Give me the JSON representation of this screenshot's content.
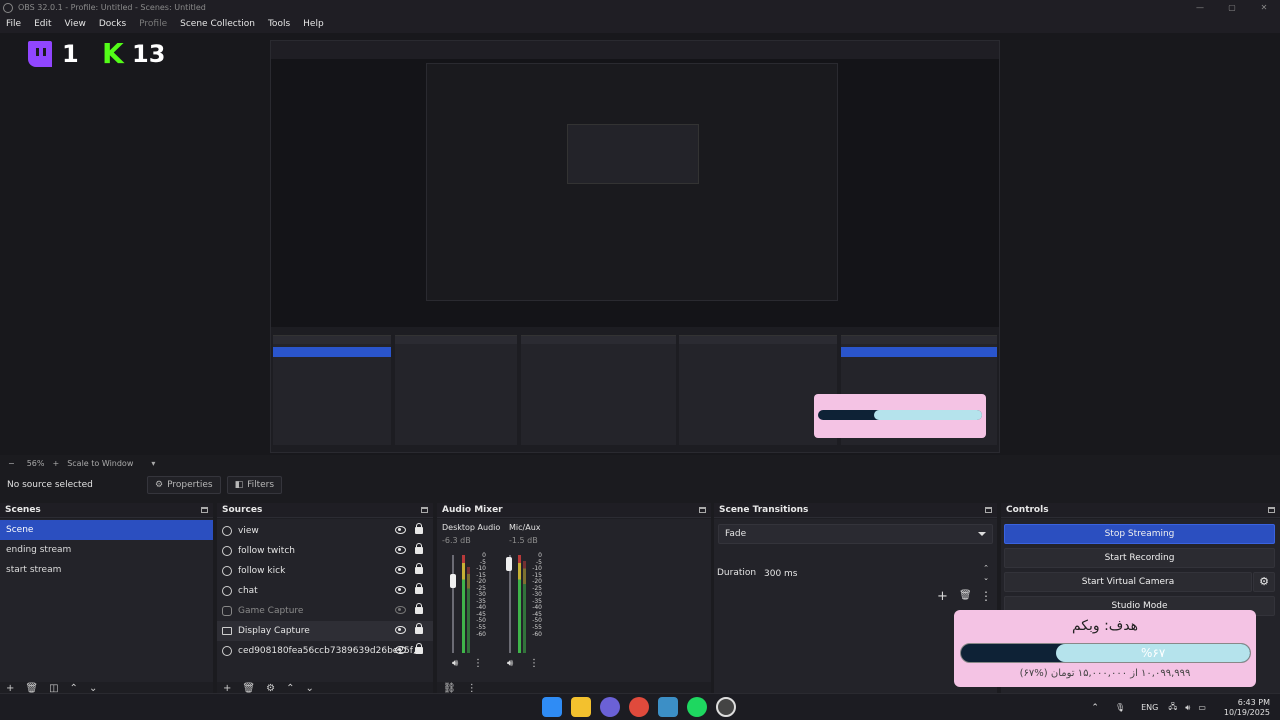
{
  "window": {
    "title": "OBS 32.0.1 - Profile: Untitled - Scenes: Untitled",
    "controls": [
      "—",
      "▢",
      "✕"
    ]
  },
  "menu": [
    "File",
    "Edit",
    "View",
    "Docks",
    "Profile",
    "Scene Collection",
    "Tools",
    "Help"
  ],
  "menu_disabled": [
    "Profile"
  ],
  "preview": {
    "twitch_count": "1",
    "kick_count": "13",
    "twitch_color": "#9146ff",
    "kick_color": "#53fc18"
  },
  "zoom": {
    "minus": "−",
    "level": "56%",
    "plus": "+",
    "mode": "Scale to Window",
    "caret": "▾"
  },
  "source_toolbar": {
    "no_source": "No source selected",
    "properties": "Properties",
    "filters": "Filters",
    "properties_icon": "gear-icon",
    "filters_icon": "filter-icon"
  },
  "scenes": {
    "title": "Scenes",
    "items": [
      "Scene",
      "ending stream",
      "start stream"
    ],
    "selected": "Scene"
  },
  "sources": {
    "title": "Sources",
    "items": [
      {
        "name": "view",
        "icon": "browser-icon"
      },
      {
        "name": "follow twitch",
        "icon": "browser-icon"
      },
      {
        "name": "follow kick",
        "icon": "browser-icon"
      },
      {
        "name": "chat",
        "icon": "browser-icon"
      },
      {
        "name": "Game Capture",
        "icon": "gamepad-icon"
      },
      {
        "name": "Display Capture",
        "icon": "monitor-icon"
      },
      {
        "name": "ced908180fea56ccb7389639d26be25f,",
        "icon": "browser-icon"
      }
    ]
  },
  "mixer": {
    "title": "Audio Mixer",
    "channels": [
      {
        "name": "Desktop Audio",
        "db": "-6.3 dB"
      },
      {
        "name": "Mic/Aux",
        "db": "-1.5 dB"
      }
    ],
    "scale": [
      "0",
      "-5",
      "-10",
      "-15",
      "-20",
      "-25",
      "-30",
      "-35",
      "-40",
      "-45",
      "-50",
      "-55",
      "-60"
    ]
  },
  "transitions": {
    "title": "Scene Transitions",
    "transition": "Fade",
    "duration_label": "Duration",
    "duration_value": "300 ms"
  },
  "controls": {
    "title": "Controls",
    "buttons": [
      "Stop Streaming",
      "Start Recording",
      "Start Virtual Camera",
      "Studio Mode"
    ]
  },
  "goal": {
    "title": "هدف: وبکم",
    "percent": "%۶۷",
    "progress": 0.67,
    "subtitle": "۱۰,۰۹۹,۹۹۹ از ۱۵,۰۰۰,۰۰۰ تومان (%۶۷)"
  },
  "taskbar": {
    "lang": "ENG",
    "time": "6:43 PM",
    "date": "10/19/2025"
  }
}
